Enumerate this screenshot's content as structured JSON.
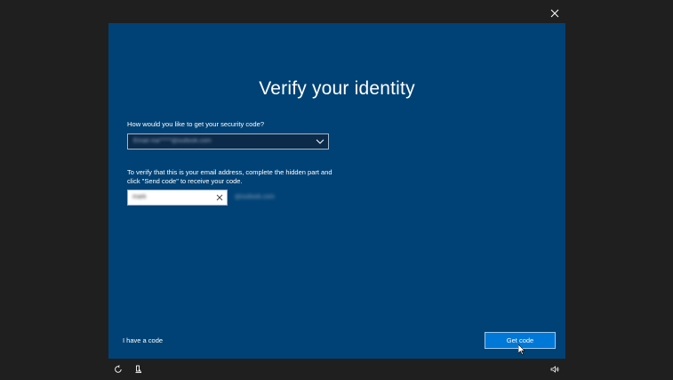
{
  "window": {
    "close_icon": "close-icon"
  },
  "dialog": {
    "title": "Verify your identity",
    "method_label": "How would you like to get your security code?",
    "method_selected": "Email ma*****@outlook.com",
    "instructions": "To verify that this is your email address, complete the hidden part and click \"Send code\" to receive your code.",
    "email_value": "mark",
    "email_domain_hint": "@outlook.com",
    "have_code_link": "I have a code",
    "get_code_button": "Get code"
  },
  "taskbar": {
    "icons": [
      "ease-of-access-icon",
      "accessibility-icon",
      "volume-icon"
    ]
  },
  "colors": {
    "dialog_bg": "#004275",
    "page_bg": "#1f1f1f",
    "accent": "#0078d7"
  }
}
